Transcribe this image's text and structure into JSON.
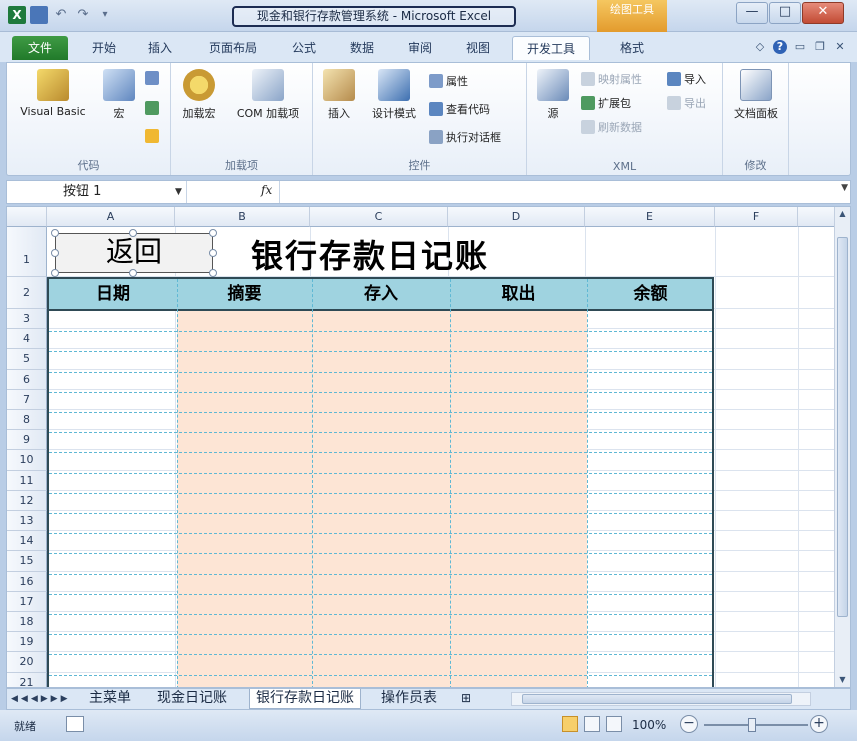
{
  "window": {
    "title": "现金和银行存款管理系统 - Microsoft Excel",
    "contextual_tab": "绘图工具",
    "controls": {
      "minimize": "—",
      "maximize": "□",
      "close": "✕"
    }
  },
  "quick_access": {
    "undo": "↶",
    "redo": "↷",
    "customize": "▾"
  },
  "tabs": [
    "文件",
    "开始",
    "插入",
    "页面布局",
    "公式",
    "数据",
    "审阅",
    "视图",
    "开发工具",
    "格式"
  ],
  "active_tab": "开发工具",
  "ribbon": {
    "code": {
      "label": "代码",
      "visual_basic": "Visual Basic",
      "macros": "宏"
    },
    "addins": {
      "label": "加载项",
      "addins": "加载宏",
      "com_addins": "COM 加载项"
    },
    "controls": {
      "label": "控件",
      "insert": "插入",
      "design_mode": "设计模式",
      "properties": "属性",
      "view_code": "查看代码",
      "run_dialog": "执行对话框"
    },
    "xml": {
      "label": "XML",
      "source": "源",
      "map_properties": "映射属性",
      "expansion_packs": "扩展包",
      "refresh_data": "刷新数据",
      "import": "导入",
      "export": "导出"
    },
    "modify": {
      "label": "修改",
      "document_panel": "文档面板"
    }
  },
  "formula_bar": {
    "name_box": "按钮 1",
    "fx": "fx",
    "value": ""
  },
  "grid": {
    "columns": [
      "A",
      "B",
      "C",
      "D",
      "E",
      "F"
    ],
    "rows": [
      "1",
      "2",
      "3",
      "4",
      "5",
      "6",
      "7",
      "8",
      "9",
      "10",
      "11",
      "12",
      "13",
      "14",
      "15",
      "16",
      "17",
      "18",
      "19",
      "20",
      "21"
    ]
  },
  "sheet": {
    "title": "银行存款日记账",
    "back_button": "返回",
    "headers": [
      "日期",
      "摘要",
      "存入",
      "取出",
      "余额"
    ]
  },
  "sheet_tabs": [
    "主菜单",
    "现金日记账",
    "银行存款日记账",
    "操作员表"
  ],
  "active_sheet": "银行存款日记账",
  "status": {
    "ready": "就绪",
    "zoom": "100%",
    "zoom_out": "−",
    "zoom_in": "+"
  },
  "colors": {
    "header_fill": "#9fd3e0",
    "body_fill": "#fde5d5",
    "dash_line": "#5fb8d4",
    "file_tab": "#217a2a"
  }
}
